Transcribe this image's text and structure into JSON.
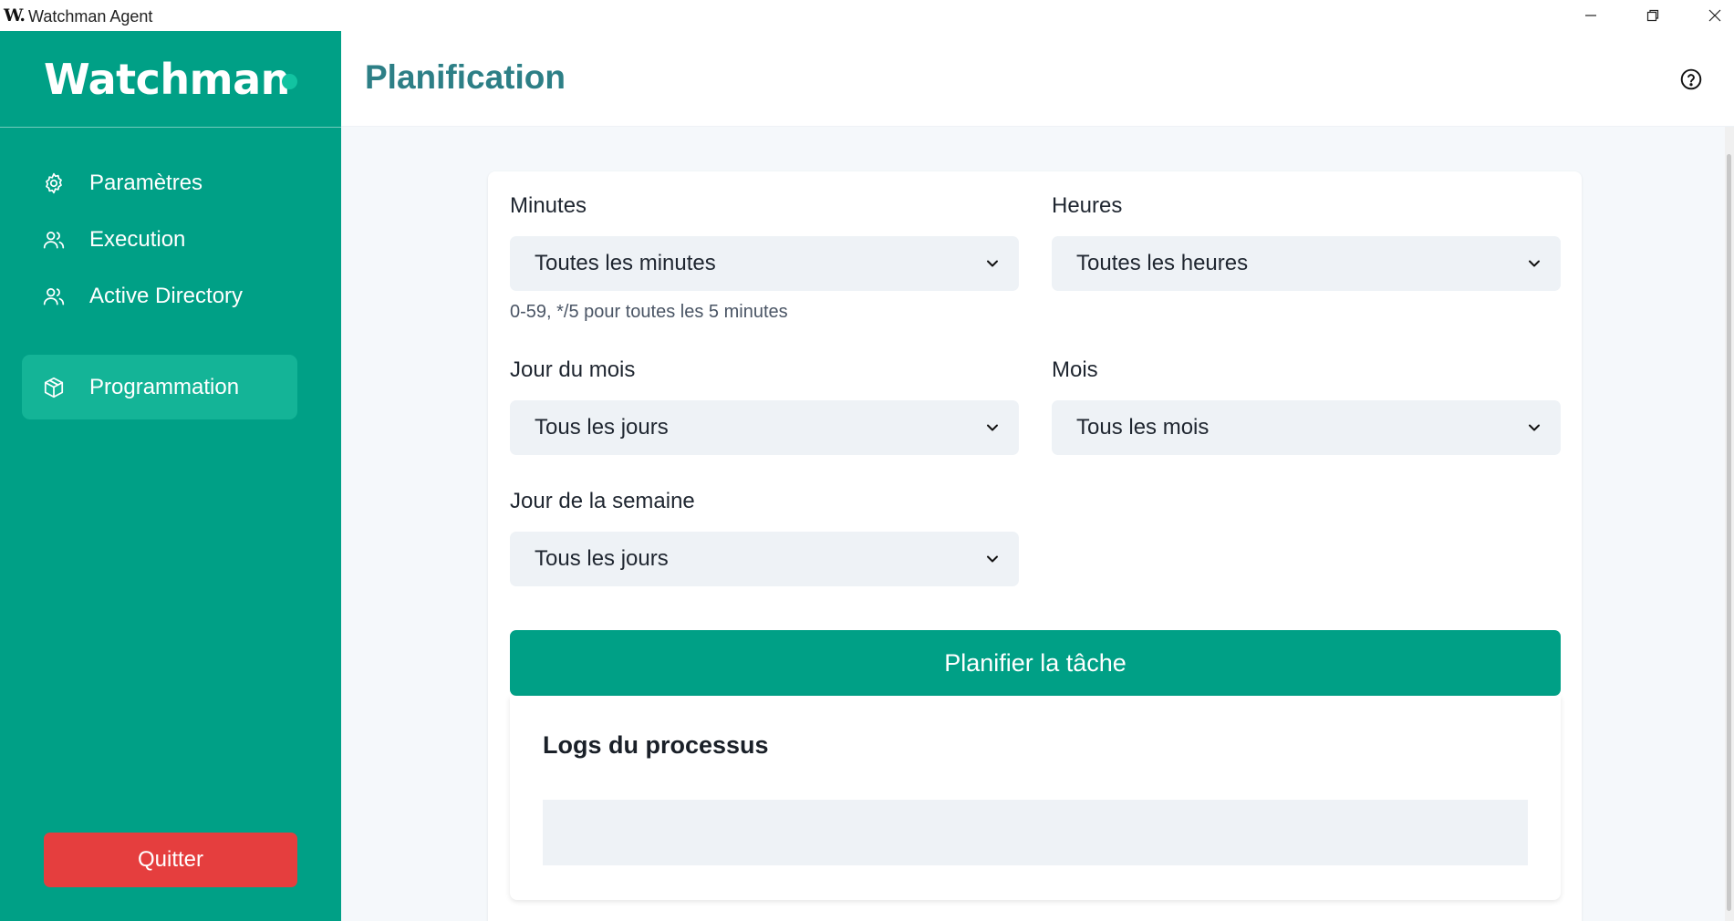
{
  "window": {
    "logo_mark": "W.",
    "title": "Watchman Agent"
  },
  "sidebar": {
    "brand": "Watchman",
    "items": [
      {
        "label": "Paramètres",
        "icon": "gear-icon",
        "active": false
      },
      {
        "label": "Execution",
        "icon": "users-icon",
        "active": false
      },
      {
        "label": "Active Directory",
        "icon": "users-icon",
        "active": false
      },
      {
        "label": "Programmation",
        "icon": "cube-icon",
        "active": true
      }
    ],
    "quit_label": "Quitter"
  },
  "header": {
    "title": "Planification",
    "help_icon": "help-circle-icon"
  },
  "form": {
    "minutes": {
      "label": "Minutes",
      "value": "Toutes les minutes",
      "hint": "0-59, */5 pour toutes les 5 minutes"
    },
    "hours": {
      "label": "Heures",
      "value": "Toutes les heures"
    },
    "day_of_month": {
      "label": "Jour du mois",
      "value": "Tous les jours"
    },
    "month": {
      "label": "Mois",
      "value": "Tous les mois"
    },
    "day_of_week": {
      "label": "Jour de la semaine",
      "value": "Tous les jours"
    },
    "submit_label": "Planifier la tâche"
  },
  "logs": {
    "title": "Logs du processus"
  },
  "colors": {
    "brand": "#00a086",
    "active_nav": "#14b497",
    "danger": "#e53e3e",
    "title": "#2d7f86"
  }
}
